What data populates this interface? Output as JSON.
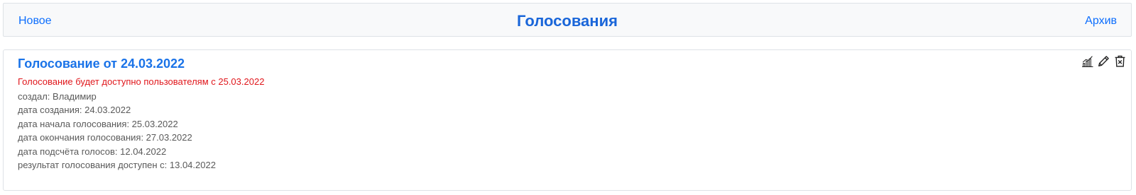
{
  "header": {
    "new_label": "Новое",
    "title": "Голосования",
    "archive_label": "Архив"
  },
  "poll": {
    "title": "Голосование от 24.03.2022",
    "notice": "Голосование будет доступно пользователям с 25.03.2022",
    "details": [
      "создал: Владимир",
      "дата создания: 24.03.2022",
      "дата начала голосования: 25.03.2022",
      "дата окончания голосования: 27.03.2022",
      "дата подсчёта голосов: 12.04.2022",
      "результат голосования доступен с: 13.04.2022"
    ],
    "actions": [
      {
        "icon": "bar-chart-icon"
      },
      {
        "icon": "pencil-icon"
      },
      {
        "icon": "trash-icon"
      }
    ]
  },
  "colors": {
    "link": "#0d6efd",
    "title": "#1a66d9",
    "notice": "#e0161b",
    "text": "#595959",
    "header_bg": "#f8f9fa",
    "border": "#dee2e6"
  }
}
